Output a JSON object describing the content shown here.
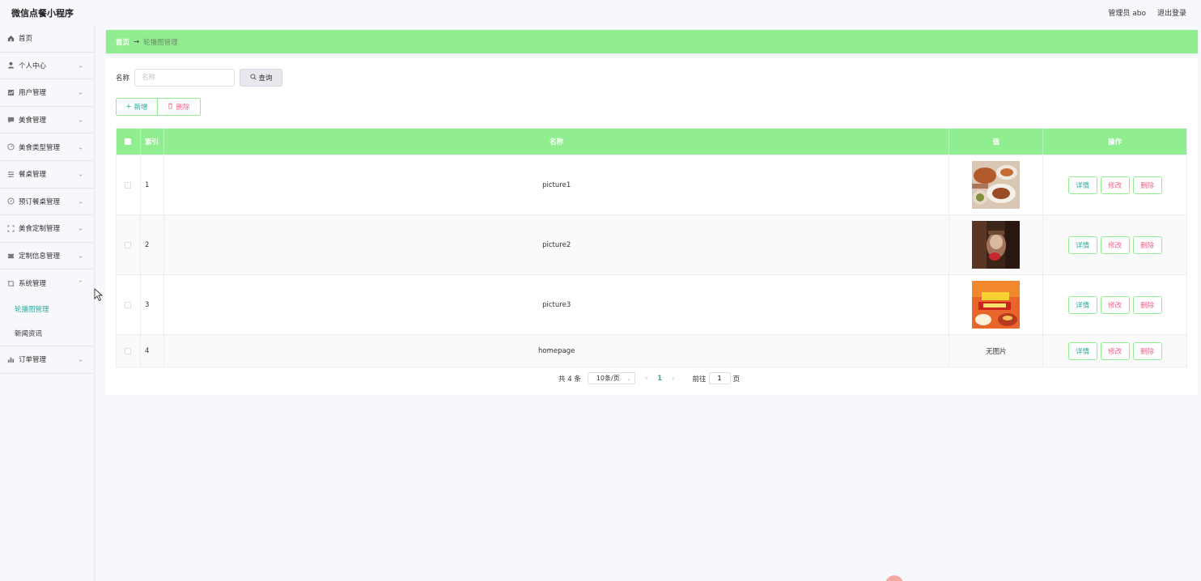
{
  "header": {
    "app_title": "微信点餐小程序",
    "user_label": "管理员 abo",
    "logout_label": "退出登录"
  },
  "sidebar": {
    "items": [
      {
        "label": "首页",
        "icon": "home-icon"
      },
      {
        "label": "个人中心",
        "icon": "user-icon"
      },
      {
        "label": "用户管理",
        "icon": "chart-icon"
      },
      {
        "label": "美食管理",
        "icon": "chat-icon"
      },
      {
        "label": "美食类型管理",
        "icon": "speed-icon"
      },
      {
        "label": "餐桌管理",
        "icon": "sliders-icon"
      },
      {
        "label": "预订餐桌管理",
        "icon": "compass-icon"
      },
      {
        "label": "美食定制管理",
        "icon": "fullscreen-icon"
      },
      {
        "label": "定制信息管理",
        "icon": "ticket-icon"
      },
      {
        "label": "系统管理",
        "icon": "crop-icon"
      }
    ],
    "sub_items": [
      {
        "label": "轮播图管理",
        "active": true
      },
      {
        "label": "新闻资讯",
        "active": false
      }
    ],
    "last_item": {
      "label": "订单管理",
      "icon": "bar-chart-icon"
    }
  },
  "breadcrumb": {
    "home": "首页",
    "current": "轮播图管理"
  },
  "search": {
    "label": "名称",
    "placeholder": "名称",
    "button_label": "查询"
  },
  "actions": {
    "add_label": "新增",
    "delete_label": "删除"
  },
  "table": {
    "headers": {
      "index": "索引",
      "name": "名称",
      "value": "值",
      "operation": "操作"
    },
    "rows": [
      {
        "index": "1",
        "name": "picture1",
        "image": "food-photo-1",
        "no_image": ""
      },
      {
        "index": "2",
        "name": "picture2",
        "image": "food-photo-2",
        "no_image": ""
      },
      {
        "index": "3",
        "name": "picture3",
        "image": "food-photo-3",
        "no_image": ""
      },
      {
        "index": "4",
        "name": "homepage",
        "image": "",
        "no_image": "无图片"
      }
    ],
    "op_labels": {
      "detail": "详情",
      "edit": "修改",
      "delete": "删除"
    }
  },
  "pagination": {
    "total": "共 4 条",
    "page_size": "10条/页",
    "current_page": "1",
    "goto_label": "前往",
    "goto_value": "1",
    "page_unit": "页"
  },
  "colors": {
    "accent_green": "#90ee90",
    "teal_text": "#2eaa9d",
    "pink_text": "#e86a8a"
  }
}
